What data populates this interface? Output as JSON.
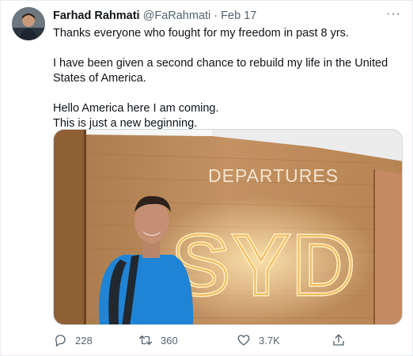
{
  "tweet": {
    "author_name": "Farhad Rahmati",
    "handle": "@FaRahmati",
    "separator": "·",
    "date": "Feb 17",
    "more": "···",
    "lines": [
      "Thanks everyone who fought for my freedom in past 8 yrs.",
      "I have been given a second chance to rebuild my life in the United States of America.",
      "Hello America here I am coming.",
      "This is just a new beginning."
    ],
    "media": {
      "sign_top": "DEPARTURES",
      "sign_big": "SYD"
    },
    "actions": {
      "replies": "228",
      "retweets": "360",
      "likes": "3.7K"
    }
  },
  "colors": {
    "text": "#0f1419",
    "muted": "#536471",
    "wood": "#b88552",
    "glow": "#f3c978",
    "shirt": "#1f84d6"
  },
  "icons": [
    "reply-icon",
    "retweet-icon",
    "like-icon",
    "share-icon",
    "more-icon"
  ]
}
